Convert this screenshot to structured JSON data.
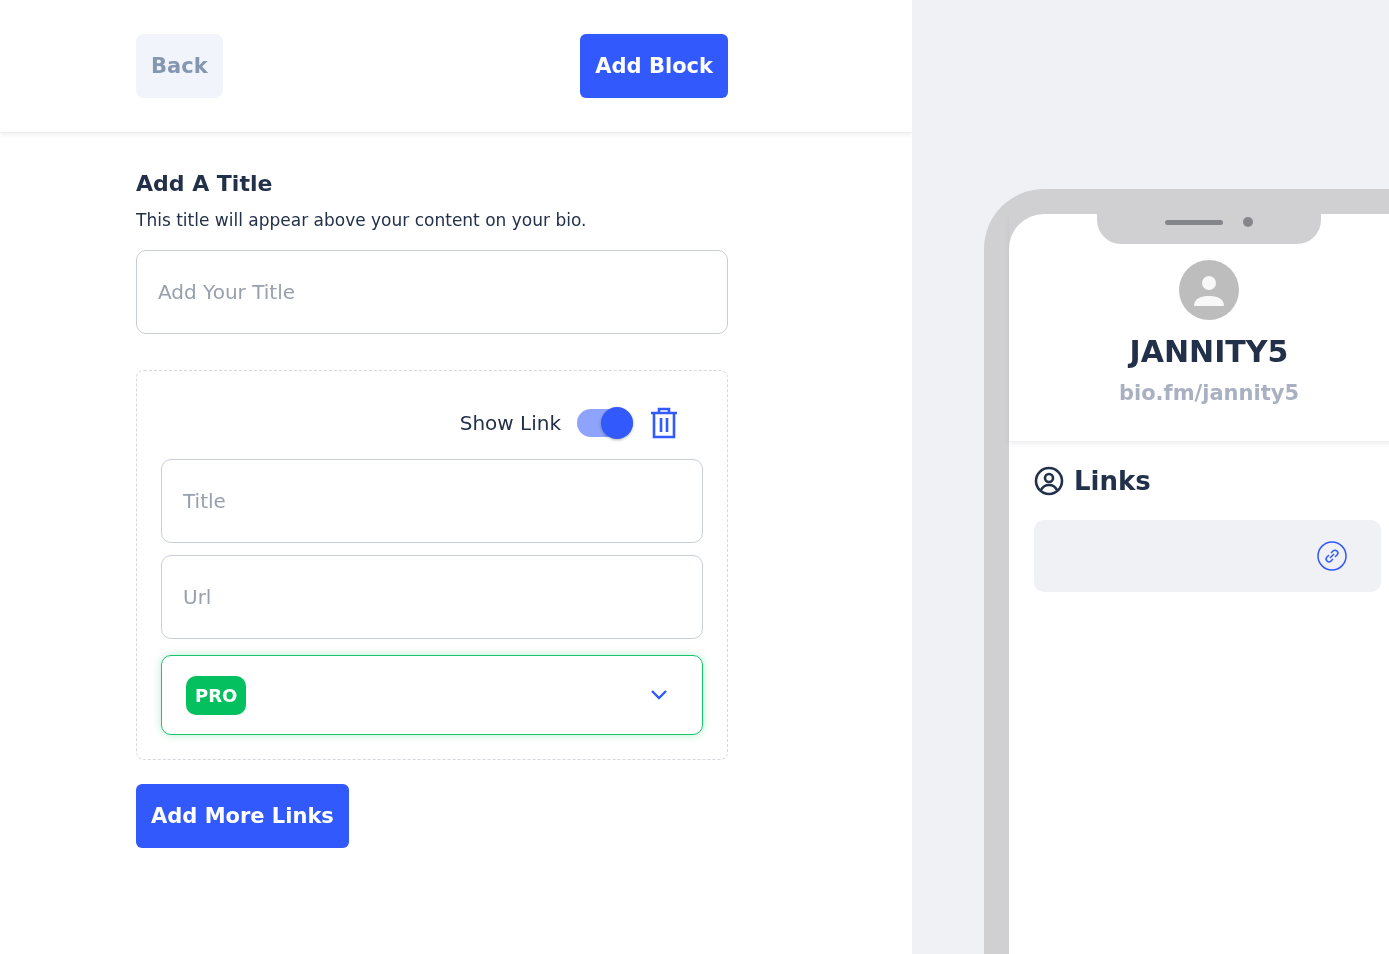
{
  "header": {
    "back_button": "Back",
    "add_block_button": "Add Block"
  },
  "title_section": {
    "heading": "Add A Title",
    "description": "This title will appear above your content on your bio.",
    "title_field": {
      "placeholder": "Add Your Title"
    }
  },
  "link_block": {
    "show_link": {
      "label": "Show Link",
      "on": true
    },
    "title_field": {
      "placeholder": "Title"
    },
    "url_field": {
      "placeholder": "Url"
    },
    "select": {
      "badge": "PRO"
    }
  },
  "add_more_button": "Add More Links",
  "preview": {
    "username": "JANNITY5",
    "url": "bio.fm/jannity5",
    "section_title": "Links"
  }
}
